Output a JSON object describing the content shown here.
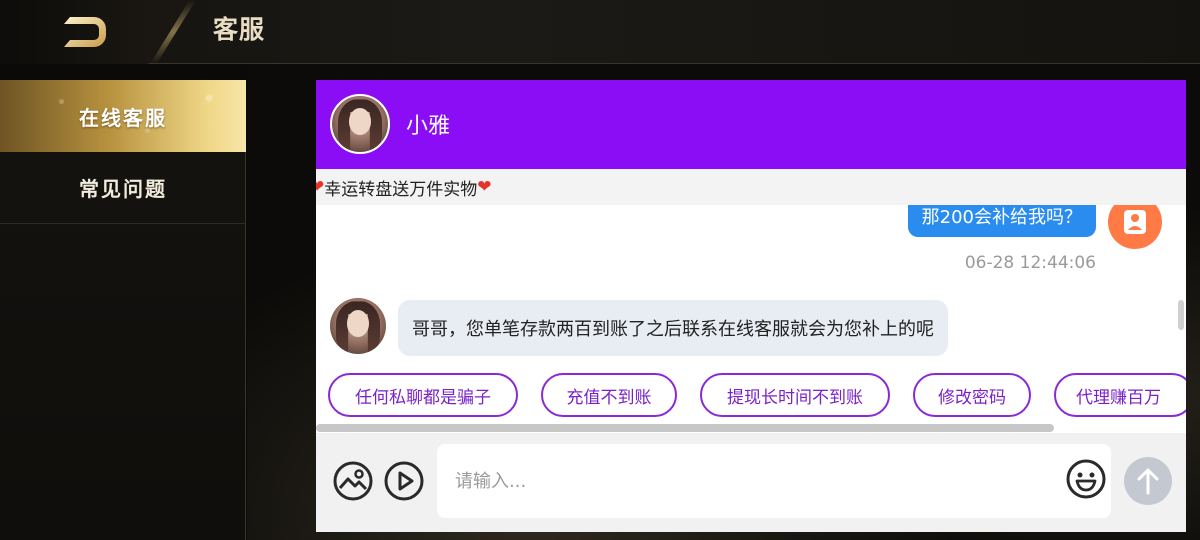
{
  "header": {
    "title": "客服",
    "back_icon": "back-arrow-icon"
  },
  "sidebar": {
    "items": [
      {
        "label": "在线客服",
        "active": true
      },
      {
        "label": "常见问题",
        "active": false
      }
    ]
  },
  "chat": {
    "agent_name": "小雅",
    "notice": {
      "text": "幸运转盘送万件实物",
      "icon": "heart-icon"
    },
    "messages": [
      {
        "from": "user",
        "text": "那200会补给我吗？",
        "time": "06-28 12:44:06"
      },
      {
        "from": "agent",
        "text": "哥哥，您单笔存款两百到账了之后联系在线客服就会为您补上的呢"
      }
    ],
    "quick_replies": [
      "任何私聊都是骗子",
      "充值不到账",
      "提现长时间不到账",
      "修改密码",
      "代理赚百万"
    ],
    "input": {
      "placeholder": "请输入..."
    },
    "icons": {
      "image": "image-icon",
      "video": "play-icon",
      "emoji": "emoji-icon",
      "send": "send-arrow-icon"
    }
  },
  "colors": {
    "header_purple": "#8a0df5",
    "user_bubble": "#2b8cf0",
    "chip_border": "#8a2ad4",
    "user_avatar": "#ff7a45",
    "gold": "#d9b668"
  }
}
